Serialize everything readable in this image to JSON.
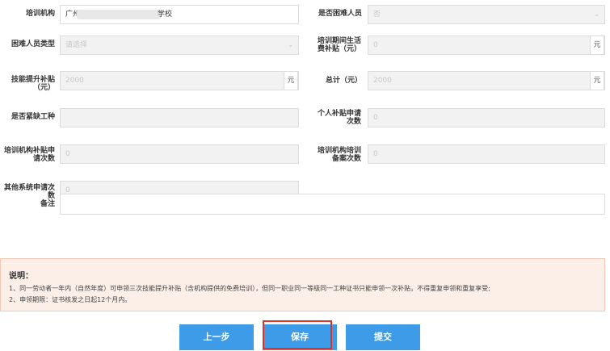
{
  "fields": {
    "org": {
      "label": "培训机构",
      "value_prefix": "广州",
      "value_suffix": "学校"
    },
    "difficult": {
      "label": "是否困难人员",
      "value": "否"
    },
    "diff_type": {
      "label": "困难人员类型",
      "placeholder": "请选择"
    },
    "living_subsidy": {
      "label": "培训期间生活费补贴（元）",
      "value": "0",
      "unit": "元"
    },
    "skill_subsidy": {
      "label": "技能提升补贴（元）",
      "value": "2000",
      "unit": "元"
    },
    "total": {
      "label": "总计（元）",
      "value": "2000",
      "unit": "元"
    },
    "shortage": {
      "label": "是否紧缺工种",
      "value": ""
    },
    "personal_count": {
      "label": "个人补贴申请次数",
      "value": "0"
    },
    "org_count": {
      "label": "培训机构补贴申请次数",
      "value": "0"
    },
    "org_record_count": {
      "label": "培训机构培训备案次数",
      "value": "0"
    },
    "other_count": {
      "label": "其他系统申请次数",
      "value": "0"
    },
    "remark": {
      "label": "备注",
      "value": ""
    }
  },
  "note": {
    "title": "说明：",
    "line1": "1、同一劳动者一年内（自然年度）可申领三次技能提升补贴（含机构提供的免费培训），但同一职业同一等级同一工种证书只能申领一次补贴，不得重复申领和重复享受;",
    "line2": "2、申领期限：证书核发之日起12个月内。"
  },
  "buttons": {
    "prev": "上一步",
    "save": "保存",
    "submit": "提交"
  },
  "colors": {
    "button": "#3e9be8",
    "highlight": "#d9342b",
    "note_bg": "#fcefe8"
  }
}
